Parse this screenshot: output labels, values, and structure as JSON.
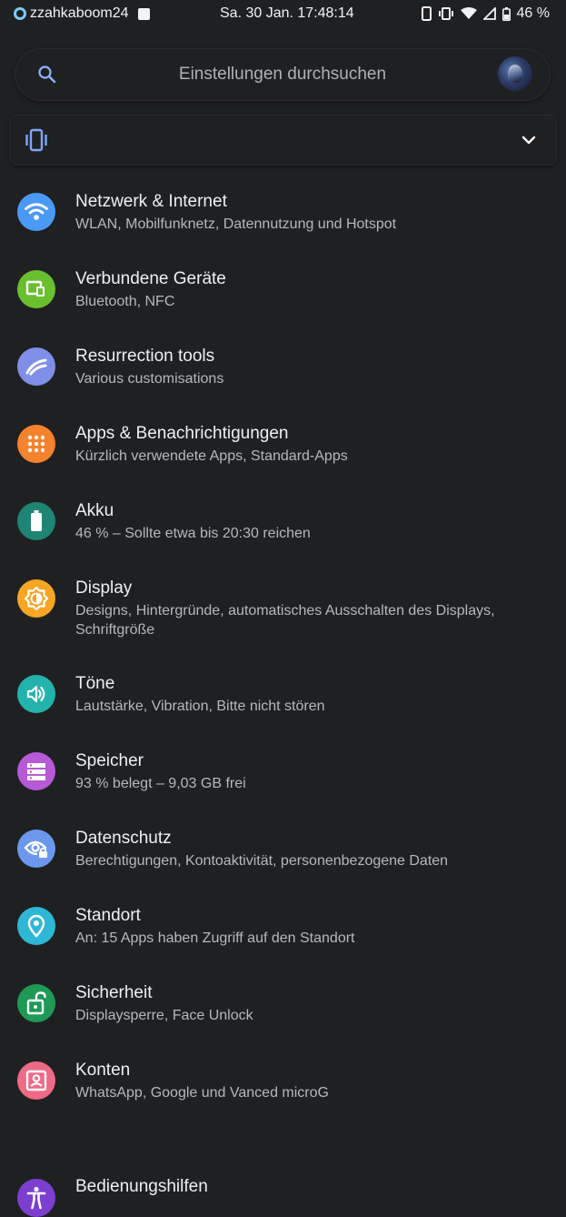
{
  "status_bar": {
    "username": "zzahkaboom24",
    "datetime": "Sa. 30 Jan. 17:48:14",
    "battery": "46 %"
  },
  "search": {
    "placeholder": "Einstellungen durchsuchen"
  },
  "condition_card": {
    "icon": "vibrate-icon"
  },
  "settings": [
    {
      "title": "Netzwerk & Internet",
      "summary": "WLAN, Mobilfunknetz, Datennutzung und Hotspot",
      "icon": "wifi-icon",
      "color": "#4a9af5"
    },
    {
      "title": "Verbundene Geräte",
      "summary": "Bluetooth, NFC",
      "icon": "devices-icon",
      "color": "#6abf2f"
    },
    {
      "title": "Resurrection tools",
      "summary": "Various customisations",
      "icon": "resurrection-icon",
      "color": "#7f8fe8"
    },
    {
      "title": "Apps & Benachrichtigungen",
      "summary": "Kürzlich verwendete Apps, Standard-Apps",
      "icon": "apps-icon",
      "color": "#f5822c"
    },
    {
      "title": "Akku",
      "summary": "46 % – Sollte etwa bis 20:30 reichen",
      "icon": "battery-icon",
      "color": "#1e8474"
    },
    {
      "title": "Display",
      "summary": "Designs, Hintergründe, automatisches Ausschalten des Displays, Schriftgröße",
      "icon": "brightness-icon",
      "color": "#f6a524"
    },
    {
      "title": "Töne",
      "summary": "Lautstärke, Vibration, Bitte nicht stören",
      "icon": "volume-icon",
      "color": "#23b3ad"
    },
    {
      "title": "Speicher",
      "summary": "93 % belegt – 9,03 GB frei",
      "icon": "storage-icon",
      "color": "#b65ad8"
    },
    {
      "title": "Datenschutz",
      "summary": "Berechtigungen, Kontoaktivität, personenbezogene Daten",
      "icon": "privacy-icon",
      "color": "#6b97ef"
    },
    {
      "title": "Standort",
      "summary": "An: 15 Apps haben Zugriff auf den Standort",
      "icon": "location-icon",
      "color": "#2eb8d6"
    },
    {
      "title": "Sicherheit",
      "summary": "Displaysperre, Face Unlock",
      "icon": "lock-icon",
      "color": "#1e9a56"
    },
    {
      "title": "Konten",
      "summary": "WhatsApp, Google und Vanced microG",
      "icon": "account-icon",
      "color": "#ee6a86"
    },
    {
      "title": "Bedienungshilfen",
      "summary": "",
      "icon": "accessibility-icon",
      "color": "#7c3fd0"
    }
  ]
}
